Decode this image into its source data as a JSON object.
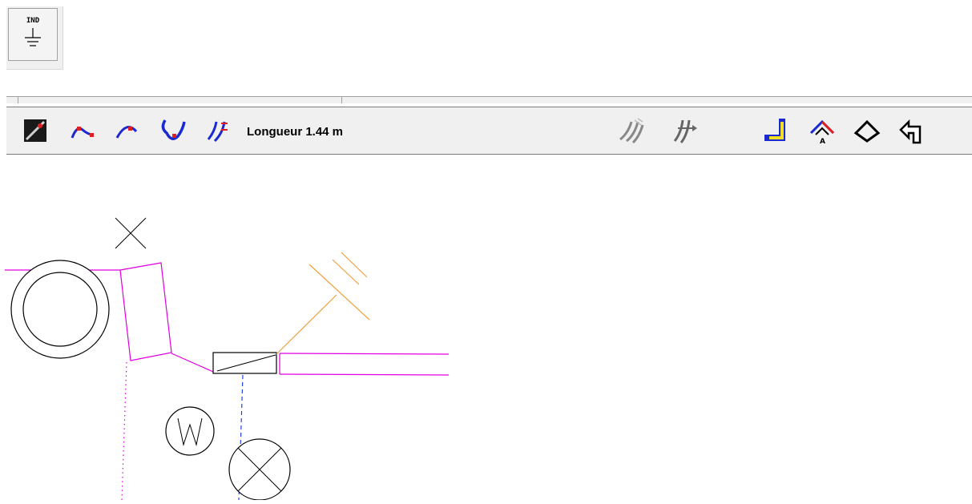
{
  "ground_tool": {
    "label": "IND",
    "icon": "ground-symbol-icon"
  },
  "toolbar": {
    "length_label": "Longueur 1.44 m",
    "left_tools": [
      {
        "name": "draw-segment-tool",
        "icon": "pen-line-icon"
      },
      {
        "name": "arc-tool",
        "icon": "arc-red-points-icon"
      },
      {
        "name": "arc-tool-2",
        "icon": "arc-small-icon"
      },
      {
        "name": "u-bend-tool",
        "icon": "u-curve-icon"
      },
      {
        "name": "double-line-tool",
        "icon": "parallel-lines-icon"
      }
    ],
    "right_tools": [
      {
        "name": "hatched-lines-tool",
        "icon": "hatched-lines-icon"
      },
      {
        "name": "lines-arrow-tool",
        "icon": "lines-arrow-icon"
      },
      {
        "name": "corner-tool",
        "icon": "corner-yellow-icon"
      },
      {
        "name": "roof-a-tool",
        "icon": "roof-a-icon"
      },
      {
        "name": "roof-outline-tool",
        "icon": "roof-outline-icon"
      },
      {
        "name": "return-arrow-tool",
        "icon": "return-arrow-icon"
      }
    ]
  },
  "drawing": {
    "symbols": [
      {
        "name": "cross-mark",
        "type": "x-marker"
      },
      {
        "name": "double-circle",
        "type": "concentric-circles"
      },
      {
        "name": "meter-box",
        "type": "rectangle"
      },
      {
        "name": "junction-box",
        "type": "rectangle-diagonal"
      },
      {
        "name": "lamp-symbol",
        "type": "circle-x"
      },
      {
        "name": "water-heater-symbol",
        "type": "circle-letter",
        "letter": "W"
      },
      {
        "name": "antenna-symbol",
        "type": "antenna"
      }
    ],
    "colors": {
      "wire_magenta": "#e000e0",
      "wire_orange": "#f0a040",
      "wire_blue": "#2040e0",
      "outline": "#000000"
    }
  }
}
